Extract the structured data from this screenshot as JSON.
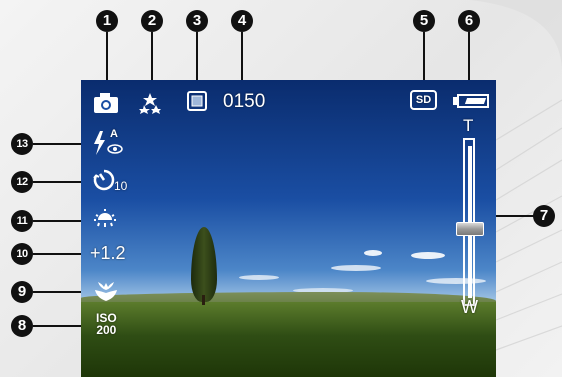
{
  "callouts": [
    "1",
    "2",
    "3",
    "4",
    "5",
    "6",
    "7",
    "8",
    "9",
    "10",
    "11",
    "12",
    "13"
  ],
  "osd": {
    "shot_count": "0150",
    "storage": "SD",
    "zoom_tele": "T",
    "zoom_wide": "W",
    "exposure": "+1.2",
    "self_timer": "10",
    "flash_mode": "A",
    "iso_label": "ISO",
    "iso_value": "200",
    "zoom_level": 0.45,
    "battery_level": 0.8
  },
  "icons": {
    "capture_mode": "camera-icon",
    "scene": "scene-mode-icon",
    "image_size": "image-size-icon",
    "storage": "sd-card-icon",
    "battery": "battery-icon",
    "zoom": "zoom-bar",
    "flash": "flash-auto-redeye-icon",
    "timer": "self-timer-icon",
    "white_balance": "white-balance-sunny-icon",
    "macro": "macro-icon",
    "iso": "iso-icon"
  },
  "colors": {
    "callout": "#111111",
    "osd": "#ffffff",
    "sky": "#1a4ea3"
  }
}
